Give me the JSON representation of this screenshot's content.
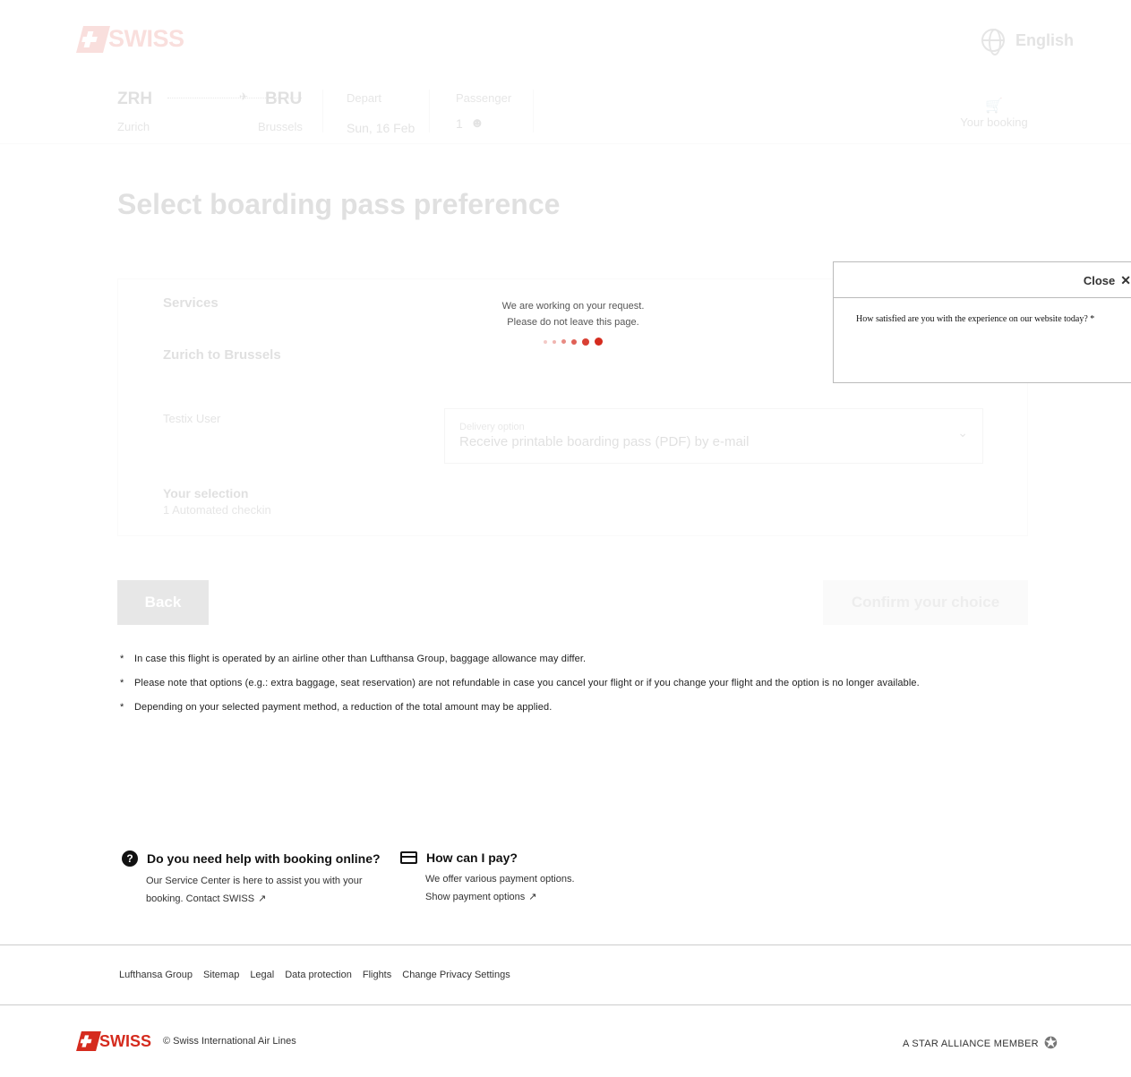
{
  "header": {
    "brand": "SWISS",
    "language": "English",
    "booking_label": "Your booking"
  },
  "itinerary": {
    "origin_code": "ZRH",
    "origin_city": "Zurich",
    "destination_code": "BRU",
    "destination_city": "Brussels",
    "depart_label": "Depart",
    "depart_value": "Sun, 16 Feb",
    "passenger_label": "Passenger",
    "passenger_value": "1"
  },
  "page": {
    "title": "Select boarding pass preference"
  },
  "services": {
    "title": "Services",
    "route": "Zurich to Brussels",
    "passenger_name": "Testix User",
    "delivery_label": "Delivery option",
    "delivery_value": "Receive printable boarding pass (PDF) by e-mail",
    "selection_title": "Your selection",
    "selection_value": "1 Automated checkin"
  },
  "buttons": {
    "back": "Back",
    "confirm": "Confirm your choice"
  },
  "loader": {
    "line1": "We are working on your request.",
    "line2": "Please do not leave this page."
  },
  "survey": {
    "close_label": "Close",
    "question": "How satisfied are you with the experience on our website today? *"
  },
  "notes": [
    "In case this flight is operated by an airline other than Lufthansa Group, baggage allowance may differ.",
    "Please note that options (e.g.: extra baggage, seat reservation) are not refundable in case you cancel your flight or if you change your flight and the option is no longer available.",
    "Depending on your selected payment method, a reduction of the total amount may be applied."
  ],
  "help": {
    "booking_title": "Do you need help with booking online?",
    "booking_text": "Our Service Center is here to assist you with your booking.",
    "booking_link": "Contact SWISS",
    "pay_title": "How can I pay?",
    "pay_text": "We offer various payment options.",
    "pay_link": "Show payment options"
  },
  "footer": {
    "links": [
      "Lufthansa Group",
      "Sitemap",
      "Legal",
      "Data protection",
      "Flights",
      "Change Privacy Settings"
    ],
    "brand": "SWISS",
    "copyright": "©  Swiss International Air Lines",
    "alliance": "A STAR ALLIANCE MEMBER"
  },
  "colors": {
    "brand_red": "#d52b1e"
  }
}
